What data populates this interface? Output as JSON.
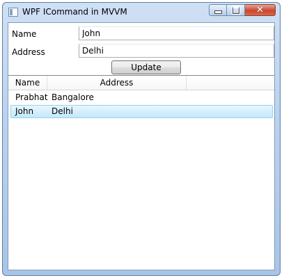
{
  "window": {
    "title": "WPF ICommand in MVVM"
  },
  "form": {
    "name_label": "Name",
    "name_value": "John",
    "address_label": "Address",
    "address_value": "Delhi",
    "update_label": "Update"
  },
  "list": {
    "columns": [
      "Name",
      "Address"
    ],
    "rows": [
      {
        "name": "Prabhat",
        "address": "Bangalore",
        "selected": false
      },
      {
        "name": "John",
        "address": "Delhi",
        "selected": true
      }
    ]
  }
}
